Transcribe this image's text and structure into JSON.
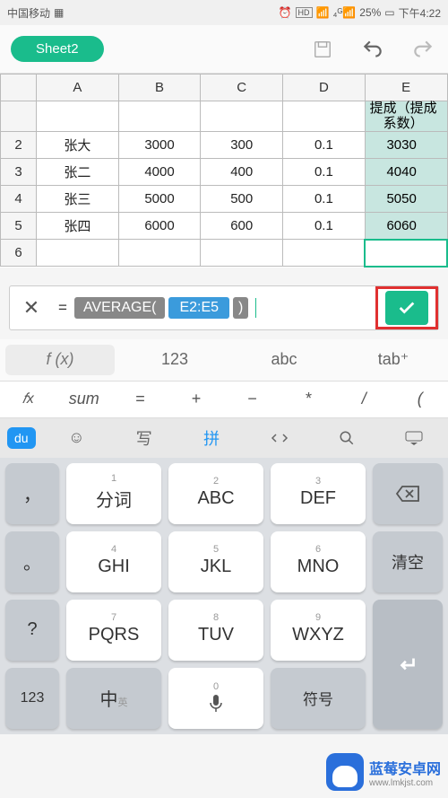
{
  "status": {
    "carrier": "中国移动",
    "indicators": "⏰ HD 📶 📶 25%",
    "battery_pct": "25%",
    "time": "下午4:22"
  },
  "toolbar": {
    "sheet_name": "Sheet2"
  },
  "sheet": {
    "cols": [
      "A",
      "B",
      "C",
      "D",
      "E"
    ],
    "e_header": "提成（提成系数）",
    "rows": [
      {
        "n": "2",
        "a": "张大",
        "b": "3000",
        "c": "300",
        "d": "0.1",
        "e": "3030"
      },
      {
        "n": "3",
        "a": "张二",
        "b": "4000",
        "c": "400",
        "d": "0.1",
        "e": "4040"
      },
      {
        "n": "4",
        "a": "张三",
        "b": "5000",
        "c": "500",
        "d": "0.1",
        "e": "5050"
      },
      {
        "n": "5",
        "a": "张四",
        "b": "6000",
        "c": "600",
        "d": "0.1",
        "e": "6060"
      }
    ],
    "active_row": "6"
  },
  "formula": {
    "eq": "=",
    "func": "AVERAGE(",
    "range": "E2:E5",
    "close": ")"
  },
  "modes": {
    "fx": "f (x)",
    "num": "123",
    "abc": "abc",
    "tab": "tab⁺"
  },
  "ops": {
    "fx": "𝑓x",
    "sum": "sum",
    "eq": "=",
    "plus": "+",
    "minus": "−",
    "mul": "*",
    "div": "/",
    "paren": "("
  },
  "ime": {
    "logo": "du",
    "emoji": "☺",
    "write": "写",
    "pin": "拼",
    "code": "⋯",
    "search": "🔍",
    "down": "▾"
  },
  "keys": {
    "r1": {
      "side1": "，",
      "k1s": "1",
      "k1": "分词",
      "k2s": "2",
      "k2": "ABC",
      "k3s": "3",
      "k3": "DEF",
      "side2": "⌫"
    },
    "r2": {
      "side1": "。",
      "k1s": "4",
      "k1": "GHI",
      "k2s": "5",
      "k2": "JKL",
      "k3s": "6",
      "k3": "MNO",
      "side2": "清空"
    },
    "r3": {
      "side1": "?",
      "k1s": "7",
      "k1": "PQRS",
      "k2s": "8",
      "k2": "TUV",
      "k3s": "9",
      "k3": "WXYZ",
      "side2": ""
    },
    "r4": {
      "k1": "123",
      "k2": "中",
      "k2sub": "英",
      "k3s": "0",
      "k3": "🎤",
      "k4": "符号",
      "side2": "↵"
    }
  },
  "watermark": {
    "cn": "蓝莓安卓网",
    "url": "www.lmkjst.com"
  }
}
